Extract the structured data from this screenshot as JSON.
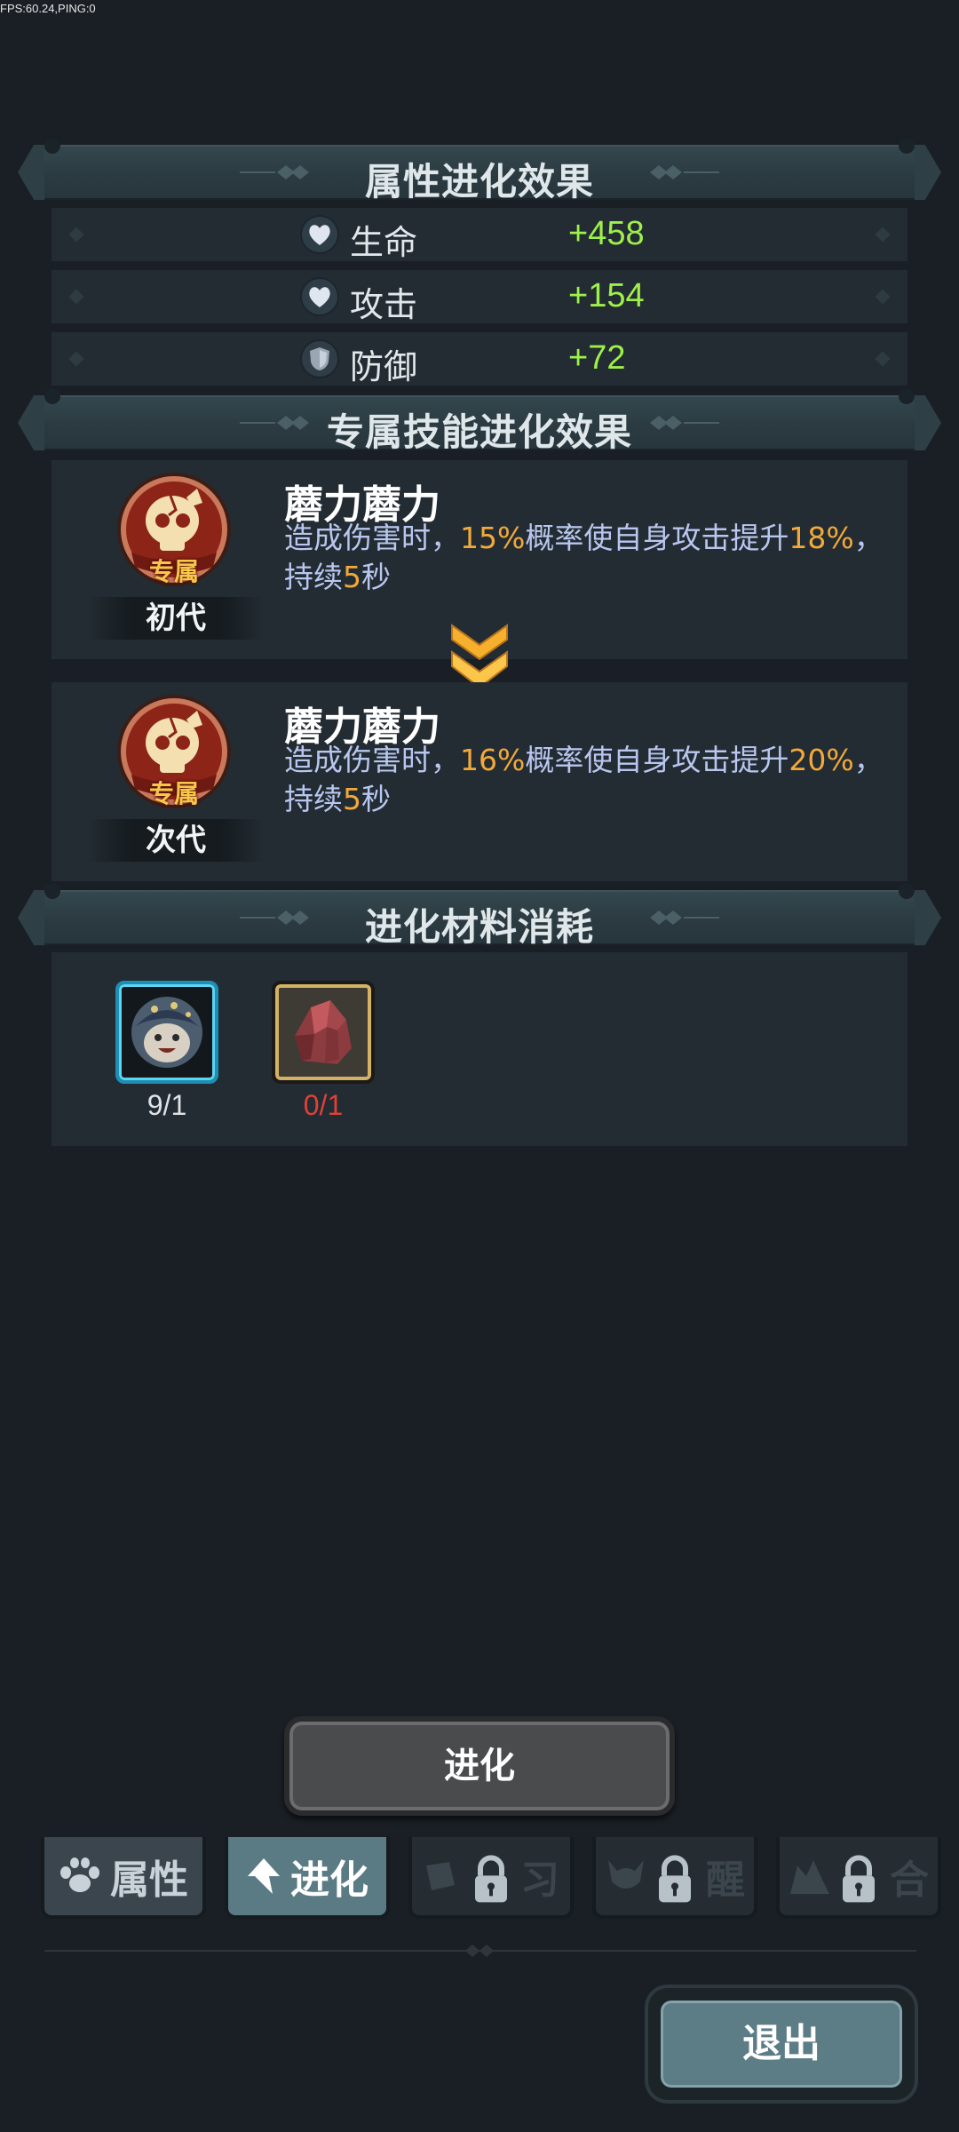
{
  "status": {
    "fps_text": "FPS:60.24,PING:0"
  },
  "attr_section": {
    "title": "属性进化效果",
    "stats": [
      {
        "icon": "heart-icon",
        "name": "生命",
        "value": "+458"
      },
      {
        "icon": "heart-icon",
        "name": "攻击",
        "value": "+154"
      },
      {
        "icon": "shield-icon",
        "name": "防御",
        "value": "+72"
      }
    ]
  },
  "skill_section": {
    "title": "专属技能进化效果",
    "current": {
      "badge": "专属",
      "tier": "初代",
      "name": "蘑力蘑力",
      "desc_a": "造成伤害时，",
      "pct_chance": "15%",
      "desc_b": "概率使自身攻击提升",
      "pct_boost": "18%",
      "desc_c": "，持续",
      "duration": "5",
      "desc_d": "秒"
    },
    "next": {
      "badge": "专属",
      "tier": "次代",
      "name": "蘑力蘑力",
      "desc_a": "造成伤害时，",
      "pct_chance": "16%",
      "desc_b": "概率使自身攻击提升",
      "pct_boost": "20%",
      "desc_c": "，持续",
      "duration": "5",
      "desc_d": "秒"
    }
  },
  "material_section": {
    "title": "进化材料消耗",
    "items": [
      {
        "icon": "mushroom-hero-icon",
        "count": "9/1",
        "count_color": "#dfe3e6"
      },
      {
        "icon": "red-crystal-icon",
        "count": "0/1",
        "count_color": "#e0403a"
      }
    ]
  },
  "evolve_button": {
    "label": "进化"
  },
  "tabs": [
    {
      "label": "属性",
      "icon": "paw-icon",
      "state": "normal"
    },
    {
      "label": "进化",
      "icon": "arrow-up-icon",
      "state": "active"
    },
    {
      "label": "习",
      "icon": "book-icon",
      "state": "locked"
    },
    {
      "label": "醒",
      "icon": "demon-icon",
      "state": "locked"
    },
    {
      "label": "合",
      "icon": "merge-icon",
      "state": "locked"
    }
  ],
  "exit_button": {
    "label": "退出"
  },
  "colors": {
    "stat_value": "#9ef04a",
    "highlight": "#f2a93b",
    "desc_text": "#b9c7f0",
    "active_tab": "#5b7b84"
  }
}
